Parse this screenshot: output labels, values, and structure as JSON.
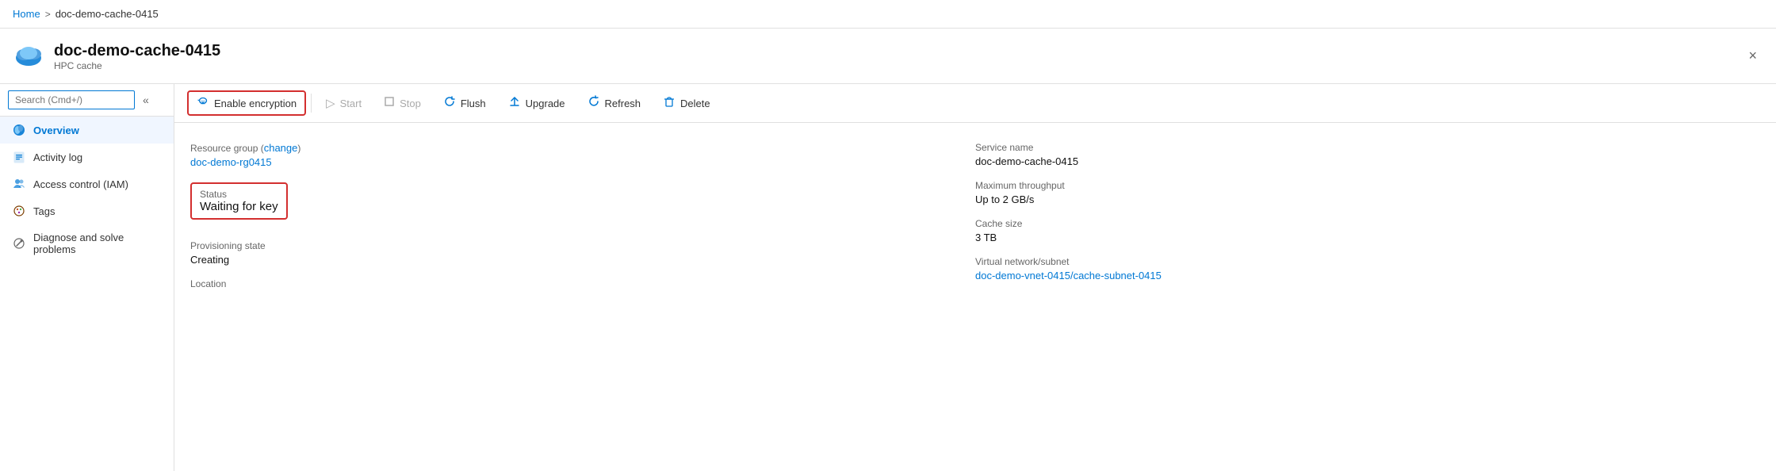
{
  "topbar": {
    "home": "Home",
    "separator": ">",
    "current": "doc-demo-cache-0415"
  },
  "header": {
    "title": "doc-demo-cache-0415",
    "subtitle": "HPC cache",
    "close_label": "×"
  },
  "search": {
    "placeholder": "Search (Cmd+/)"
  },
  "sidebar": {
    "collapse_icon": "«",
    "items": [
      {
        "label": "Overview",
        "icon": "🔵",
        "active": true
      },
      {
        "label": "Activity log",
        "icon": "📋",
        "active": false
      },
      {
        "label": "Access control (IAM)",
        "icon": "👥",
        "active": false
      },
      {
        "label": "Tags",
        "icon": "🏷️",
        "active": false
      },
      {
        "label": "Diagnose and solve problems",
        "icon": "🔧",
        "active": false
      }
    ]
  },
  "toolbar": {
    "buttons": [
      {
        "id": "enable-encryption",
        "label": "Enable encryption",
        "icon": "🔑",
        "highlighted": true,
        "disabled": false
      },
      {
        "id": "start",
        "label": "Start",
        "icon": "▷",
        "highlighted": false,
        "disabled": true
      },
      {
        "id": "stop",
        "label": "Stop",
        "icon": "□",
        "highlighted": false,
        "disabled": true
      },
      {
        "id": "flush",
        "label": "Flush",
        "icon": "↺",
        "highlighted": false,
        "disabled": false
      },
      {
        "id": "upgrade",
        "label": "Upgrade",
        "icon": "⬇",
        "highlighted": false,
        "disabled": false
      },
      {
        "id": "refresh",
        "label": "Refresh",
        "icon": "↻",
        "highlighted": false,
        "disabled": false
      },
      {
        "id": "delete",
        "label": "Delete",
        "icon": "🗑",
        "highlighted": false,
        "disabled": false
      }
    ]
  },
  "details": {
    "left": [
      {
        "label": "Resource group",
        "value": "doc-demo-rg0415",
        "value_link": true,
        "extra_label": "change",
        "extra_link": true
      },
      {
        "label": "Status",
        "value": "Waiting for key",
        "highlighted": true
      },
      {
        "label": "Provisioning state",
        "value": "Creating"
      },
      {
        "label": "Location",
        "value": ""
      }
    ],
    "right": [
      {
        "label": "Service name",
        "value": "doc-demo-cache-0415"
      },
      {
        "label": "Maximum throughput",
        "value": "Up to 2 GB/s"
      },
      {
        "label": "Cache size",
        "value": "3 TB"
      },
      {
        "label": "Virtual network/subnet",
        "value": "doc-demo-vnet-0415/cache-subnet-0415",
        "value_link": true
      }
    ]
  },
  "colors": {
    "accent": "#0078d4",
    "highlight_border": "#d32f2f",
    "active_bg": "#f0f6ff"
  }
}
